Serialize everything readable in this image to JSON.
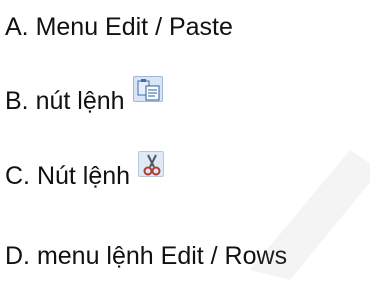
{
  "options": [
    {
      "label": "A. Menu Edit / Paste"
    },
    {
      "label": "B. nút lệnh",
      "icon": "paste-icon"
    },
    {
      "label": "C. Nút lệnh",
      "icon": "cut-scissors-icon"
    },
    {
      "label": "D. menu lệnh Edit / Rows"
    }
  ]
}
